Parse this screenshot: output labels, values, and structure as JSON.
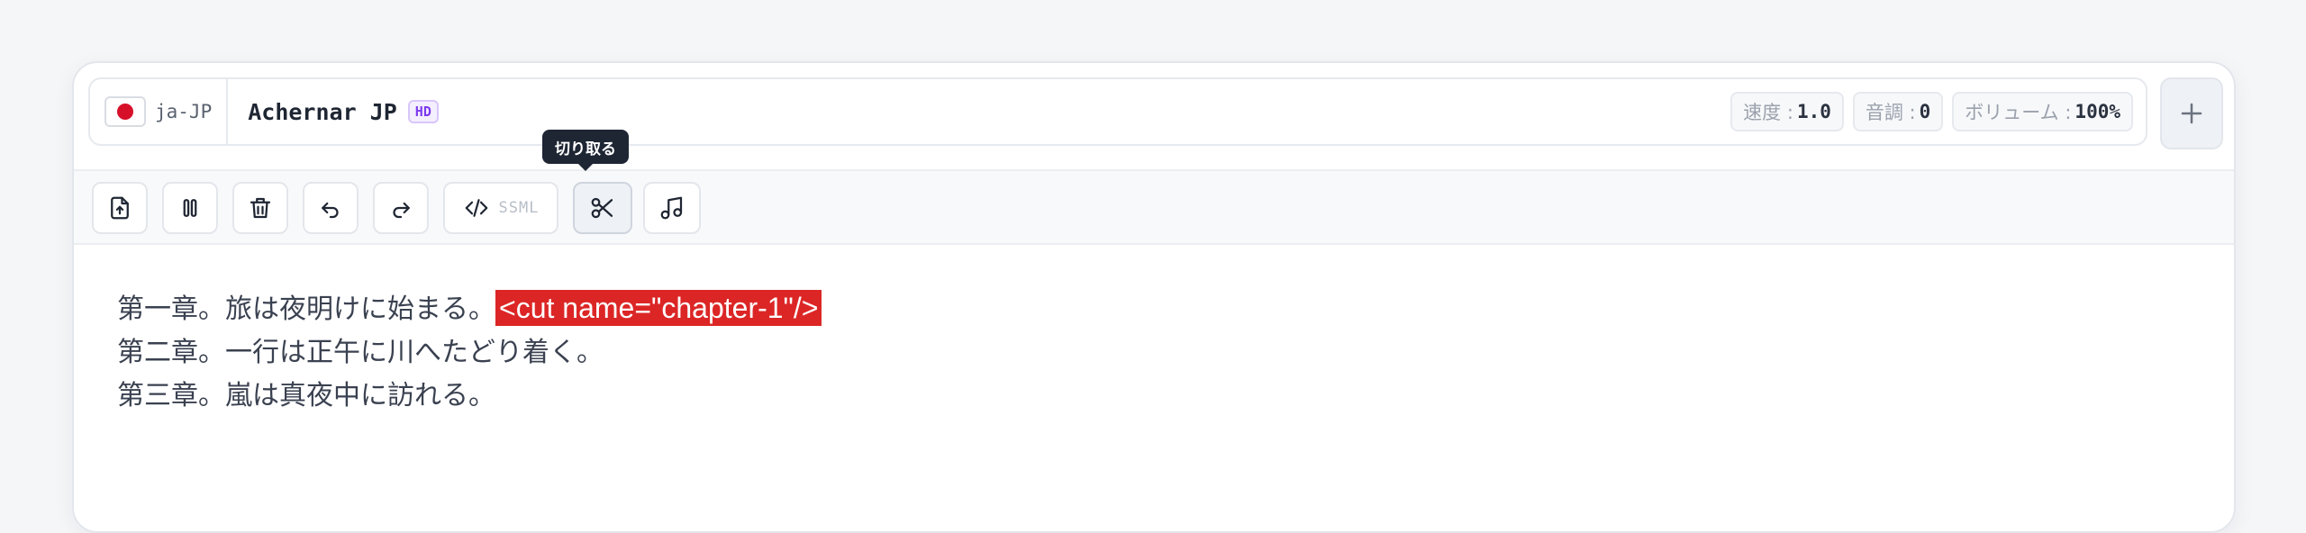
{
  "voice": {
    "lang_code": "ja-JP",
    "name": "Achernar JP",
    "badge": "HD",
    "flag_icon": "japan-flag-icon"
  },
  "params": [
    {
      "label": "速度 :",
      "value": "1.0"
    },
    {
      "label": "音調 :",
      "value": "0"
    },
    {
      "label": "ボリューム :",
      "value": "100%"
    }
  ],
  "toolbar": {
    "ssml_label": "SSML",
    "tooltip": "切り取る",
    "buttons": [
      "upload-file-icon",
      "pause-icon",
      "trash-icon",
      "undo-icon",
      "redo-icon",
      "code-icon",
      "scissors-icon",
      "music-note-icon"
    ]
  },
  "editor": {
    "line1_text": "第一章。旅は夜明けに始まる。",
    "line1_tag": "<cut name=\"chapter-1\"/>",
    "line2_text": "第二章。一行は正午に川へたどり着く。",
    "line3_text": "第三章。嵐は真夜中に訪れる。"
  },
  "colors": {
    "tag_highlight": "#dc2626",
    "badge_purple": "#7c3aed",
    "tooltip_bg": "#1e2634"
  }
}
